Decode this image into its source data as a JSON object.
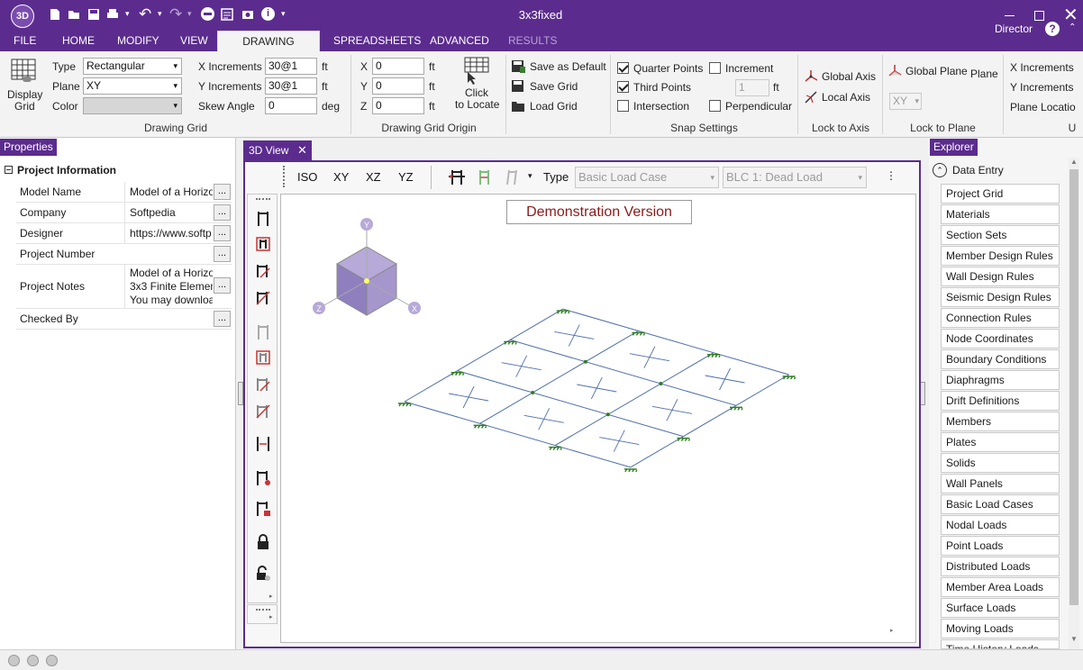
{
  "app": {
    "logo": "3D",
    "title": "3x3fixed",
    "user": "Director"
  },
  "ribbon_tabs": [
    {
      "label": "FILE"
    },
    {
      "label": "HOME"
    },
    {
      "label": "MODIFY"
    },
    {
      "label": "VIEW"
    },
    {
      "label": "DRAWING TOOLS"
    },
    {
      "label": "SPREADSHEETS"
    },
    {
      "label": "ADVANCED"
    },
    {
      "label": "RESULTS"
    }
  ],
  "drawing_grid": {
    "display_label": "Display\nGrid",
    "display_label_1": "Display",
    "display_label_2": "Grid",
    "type_label": "Type",
    "type_value": "Rectangular",
    "plane_label": "Plane",
    "plane_value": "XY",
    "color_label": "Color",
    "x_inc_label": "X Increments",
    "x_inc_value": "30@1",
    "x_unit": "ft",
    "y_inc_label": "Y Increments",
    "y_inc_value": "30@1",
    "y_unit": "ft",
    "skew_label": "Skew Angle",
    "skew_value": "0",
    "skew_unit": "deg",
    "title": "Drawing Grid"
  },
  "origin": {
    "x_label": "X",
    "x_value": "0",
    "x_unit": "ft",
    "y_label": "Y",
    "y_value": "0",
    "y_unit": "ft",
    "z_label": "Z",
    "z_value": "0",
    "z_unit": "ft",
    "click_1": "Click",
    "click_2": "to Locate",
    "title": "Drawing Grid Origin"
  },
  "grid_files": {
    "save_default": "Save as Default",
    "save": "Save Grid",
    "load": "Load Grid"
  },
  "snap": {
    "quarter": "Quarter Points",
    "third": "Third Points",
    "intersection": "Intersection",
    "increment": "Increment",
    "increment_value": "1",
    "increment_unit": "ft",
    "perpendicular": "Perpendicular",
    "title": "Snap Settings"
  },
  "lock_axis": {
    "global": "Global Axis",
    "local": "Local Axis",
    "title": "Lock to Axis"
  },
  "lock_plane": {
    "global": "Global Plane",
    "plane": "Plane",
    "plane_value": "XY",
    "title": "Lock to Plane"
  },
  "right_grid": {
    "x_inc": "X Increments",
    "y_inc": "Y Increments",
    "plane_loc": "Plane Locatio",
    "title": "U"
  },
  "properties": {
    "header": "Properties",
    "section": "Project Information",
    "rows": [
      {
        "key": "Model Name",
        "value": "Model of a Horizo"
      },
      {
        "key": "Company",
        "value": "Softpedia"
      },
      {
        "key": "Designer",
        "value": "https://www.softp"
      },
      {
        "key": "Project Number",
        "value": ""
      },
      {
        "key": "Project Notes",
        "value": "Model of a Horizo",
        "value2": "3x3 Finite Elemen",
        "value3": "You may downloa"
      },
      {
        "key": "Checked By",
        "value": ""
      }
    ]
  },
  "view": {
    "tab": "3D View",
    "iso": "ISO",
    "xy": "XY",
    "xz": "XZ",
    "yz": "YZ",
    "type_label": "Type",
    "load_type": "Basic Load Case",
    "load_case": "BLC 1: Dead Load",
    "banner": "Demonstration Version",
    "cube": {
      "y": "Y",
      "z": "Z",
      "x": "X"
    }
  },
  "explorer": {
    "header": "Explorer",
    "section": "Data Entry",
    "items": [
      "Project Grid",
      "Materials",
      "Section Sets",
      "Member Design Rules",
      "Wall Design Rules",
      "Seismic Design Rules",
      "Connection Rules",
      "Node Coordinates",
      "Boundary Conditions",
      "Diaphragms",
      "Drift Definitions",
      "Members",
      "Plates",
      "Solids",
      "Wall Panels",
      "Basic Load Cases",
      "Nodal Loads",
      "Point Loads",
      "Distributed Loads",
      "Member Area Loads",
      "Surface Loads",
      "Moving Loads",
      "Time History Loads"
    ]
  },
  "colors": {
    "brand": "#5b2c8e",
    "model_line": "#4f6fa8",
    "support": "#2e7d1e"
  }
}
